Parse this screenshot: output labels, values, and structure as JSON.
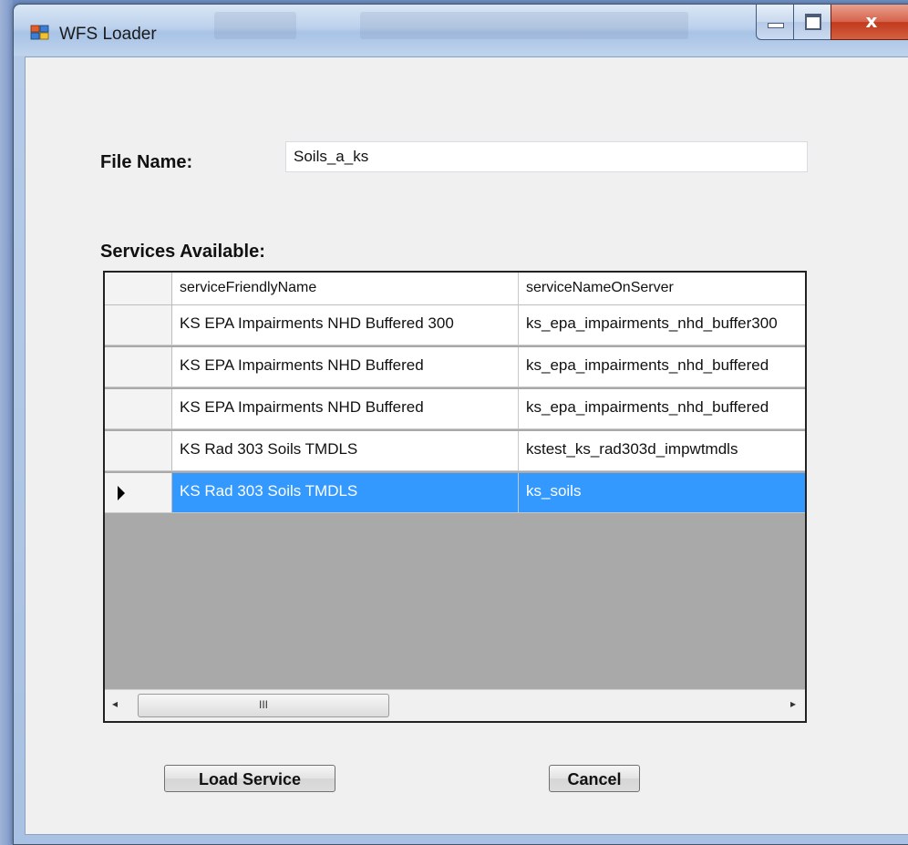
{
  "window": {
    "title": "WFS Loader"
  },
  "form": {
    "file_label": "File Name:",
    "file_value": "Soils_a_ks",
    "services_label": "Services Available:"
  },
  "grid": {
    "columns": [
      "serviceFriendlyName",
      "serviceNameOnServer"
    ],
    "rows": [
      [
        "KS EPA Impairments NHD Buffered 300",
        "ks_epa_impairments_nhd_buffer300"
      ],
      [
        "KS EPA Impairments NHD Buffered",
        "ks_epa_impairments_nhd_buffered"
      ],
      [
        "KS EPA Impairments NHD Buffered",
        "ks_epa_impairments_nhd_buffered"
      ],
      [
        "KS Rad 303 Soils TMDLS",
        "kstest_ks_rad303d_impwtmdls"
      ],
      [
        "KS Rad 303 Soils TMDLS",
        "ks_soils"
      ]
    ],
    "selected_row": 4,
    "scroll_thumb_label": "III",
    "scroll_left": "◂",
    "scroll_right": "▸"
  },
  "buttons": {
    "load": "Load Service",
    "cancel": "Cancel"
  },
  "caption": {
    "close": "x"
  },
  "colors": {
    "selection": "#3399ff",
    "grid_background": "#a9a9a9"
  }
}
